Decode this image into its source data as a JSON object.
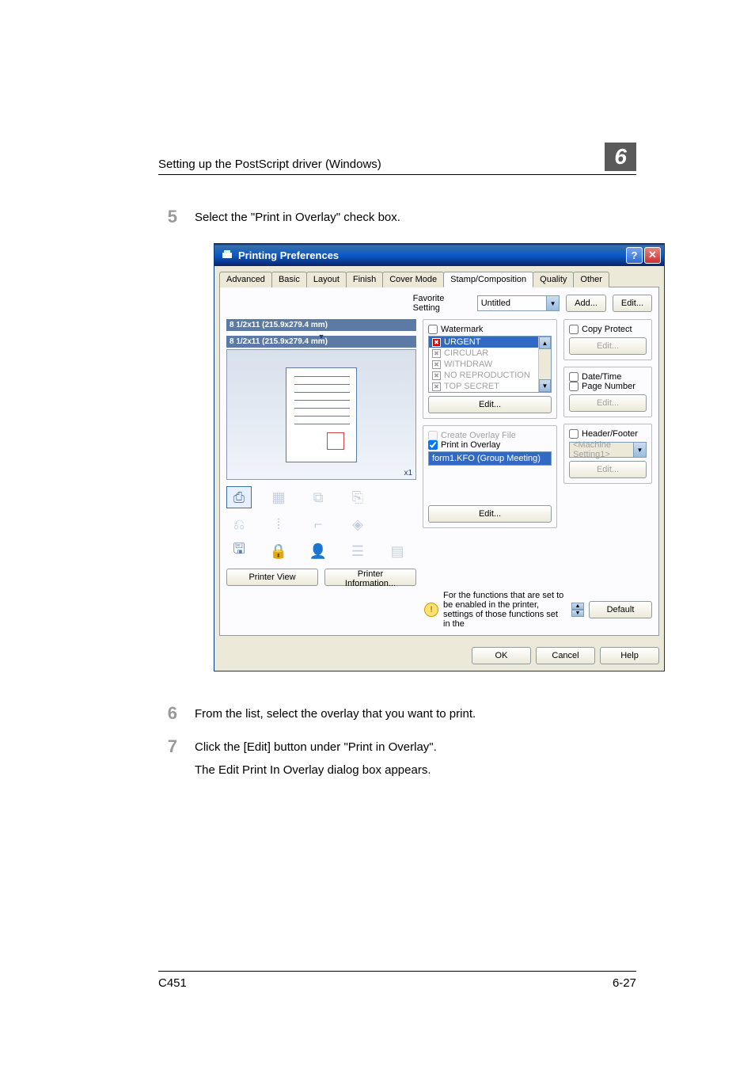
{
  "page": {
    "header": "Setting up the PostScript driver (Windows)",
    "chapter": "6",
    "model": "C451",
    "pagenum": "6-27"
  },
  "steps": {
    "s5": {
      "num": "5",
      "text": "Select the \"Print in Overlay\" check box."
    },
    "s6": {
      "num": "6",
      "text": "From the list, select the overlay that you want to print."
    },
    "s7": {
      "num": "7",
      "text": "Click the [Edit] button under \"Print in Overlay\".",
      "sub": "The Edit Print In Overlay dialog box appears."
    }
  },
  "dialog": {
    "title": "Printing Preferences",
    "tabs": {
      "advanced": "Advanced",
      "basic": "Basic",
      "layout": "Layout",
      "finish": "Finish",
      "cover": "Cover Mode",
      "stamp": "Stamp/Composition",
      "quality": "Quality",
      "other": "Other"
    },
    "favorite": {
      "label": "Favorite Setting",
      "value": "Untitled",
      "add": "Add...",
      "edit": "Edit..."
    },
    "paper": {
      "label1": "8 1/2x11 (215.9x279.4 mm)",
      "label2": "8 1/2x11 (215.9x279.4 mm)",
      "x1": "x1"
    },
    "leftbtns": {
      "view": "Printer View",
      "info": "Printer Information..."
    },
    "watermark": {
      "label": "Watermark",
      "items": {
        "i0": "URGENT",
        "i1": "CIRCULAR",
        "i2": "WITHDRAW",
        "i3": "NO REPRODUCTION",
        "i4": "TOP SECRET"
      },
      "edit": "Edit..."
    },
    "overlay": {
      "create": "Create Overlay File",
      "print": "Print in Overlay",
      "selected": "form1.KFO (Group Meeting)",
      "edit": "Edit..."
    },
    "copyprotect": {
      "label": "Copy Protect",
      "edit": "Edit..."
    },
    "datetime": {
      "date": "Date/Time",
      "page": "Page Number",
      "edit": "Edit..."
    },
    "headerfooter": {
      "label": "Header/Footer",
      "value": "<Machine Setting1>",
      "edit": "Edit..."
    },
    "note": {
      "text": "For the functions that are set to be enabled in the printer, settings of those functions set in the",
      "default": "Default"
    },
    "footer": {
      "ok": "OK",
      "cancel": "Cancel",
      "help": "Help"
    }
  }
}
